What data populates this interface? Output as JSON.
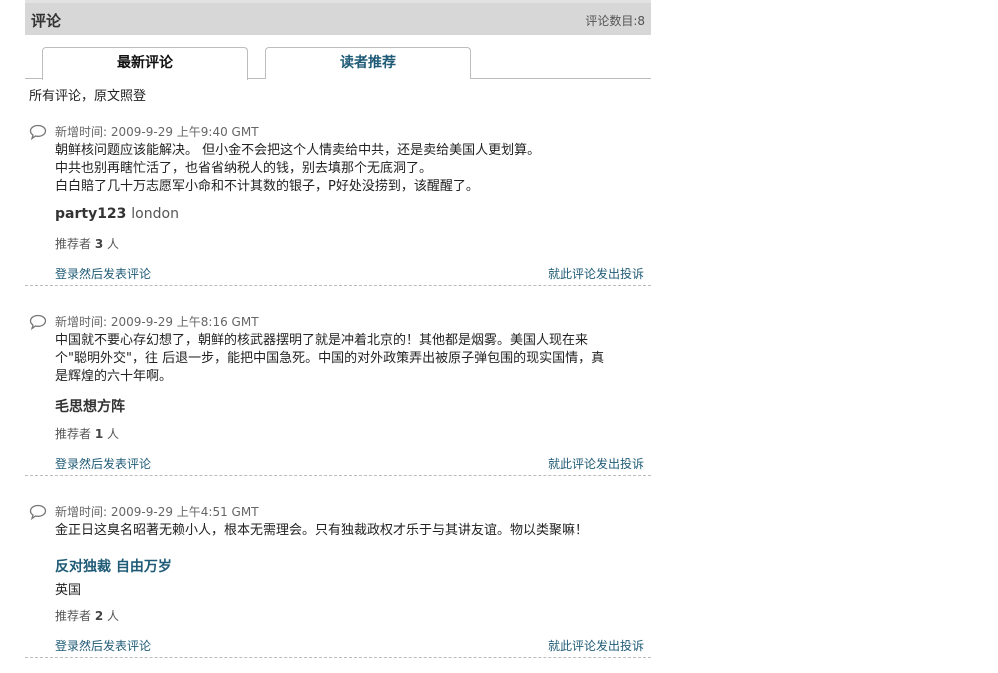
{
  "header": {
    "title": "评论",
    "count_label": "评论数目:8"
  },
  "tabs": [
    {
      "label": "最新评论"
    },
    {
      "label": "读者推荐"
    }
  ],
  "intro": "所有评论，原文照登",
  "comments": [
    {
      "meta": "新增时间: 2009-9-29 上午9:40 GMT",
      "lines": [
        "朝鲜核问题应该能解决。 但小金不会把这个人情卖给中共，还是卖给美国人更划算。",
        "中共也别再瞎忙活了，也省省纳税人的钱，别去填那个无底洞了。",
        "白白賠了几十万志愿军小命和不计其数的银子，P好处没捞到，该醒醒了。"
      ],
      "author": "party123",
      "location": "london",
      "rec_prefix": "推荐者",
      "rec_count": "3",
      "rec_suffix": "人",
      "login_label": "登录然后发表评论",
      "report_label": "就此评论发出投诉"
    },
    {
      "meta": "新增时间: 2009-9-29 上午8:16 GMT",
      "lines": [
        "中国就不要心存幻想了，朝鲜的核武器摆明了就是冲着北京的！其他都是烟雾。美国人现在来",
        "个\"聪明外交\"，往 后退一步，能把中国急死。中国的对外政策弄出被原子弹包围的现实国情，真",
        "是辉煌的六十年啊。"
      ],
      "author": "毛思想方阵",
      "location": "",
      "rec_prefix": "推荐者",
      "rec_count": "1",
      "rec_suffix": "人",
      "login_label": "登录然后发表评论",
      "report_label": "就此评论发出投诉"
    },
    {
      "meta": "新增时间: 2009-9-29 上午4:51 GMT",
      "lines": [
        "金正日这臭名昭著无赖小人，根本无需理会。只有独裁政权才乐于与其讲友谊。物以类聚嘛！"
      ],
      "author": "反对独裁 自由万岁",
      "location": "英国",
      "rec_prefix": "推荐者",
      "rec_count": "2",
      "rec_suffix": "人",
      "login_label": "登录然后发表评论",
      "report_label": "就此评论发出投诉"
    }
  ]
}
